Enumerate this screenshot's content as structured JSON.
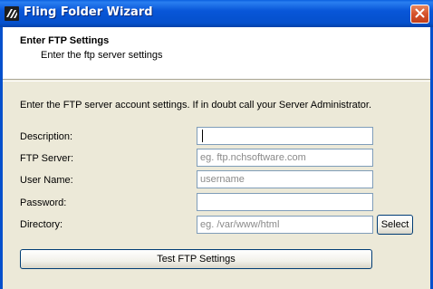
{
  "window": {
    "title": "Fling Folder Wizard",
    "icon": "fling-app-icon",
    "close_icon": "close-icon"
  },
  "header": {
    "title": "Enter FTP Settings",
    "subtitle": "Enter the ftp server settings"
  },
  "form": {
    "instruction": "Enter the FTP server account settings. If in doubt call your Server Administrator.",
    "description": {
      "label": "Description:",
      "value": "",
      "placeholder": ""
    },
    "ftp_server": {
      "label": "FTP Server:",
      "value": "",
      "placeholder": "eg. ftp.nchsoftware.com"
    },
    "user_name": {
      "label": "User Name:",
      "value": "",
      "placeholder": "username"
    },
    "password": {
      "label": "Password:",
      "value": "",
      "placeholder": ""
    },
    "directory": {
      "label": "Directory:",
      "value": "",
      "placeholder": "eg. /var/www/html"
    },
    "select_label": "Select",
    "test_label": "Test FTP Settings"
  },
  "colors": {
    "titlebar": "#0550cc",
    "close_button": "#d5532d",
    "window_bg": "#ece9d8",
    "input_border": "#7f9db9"
  }
}
